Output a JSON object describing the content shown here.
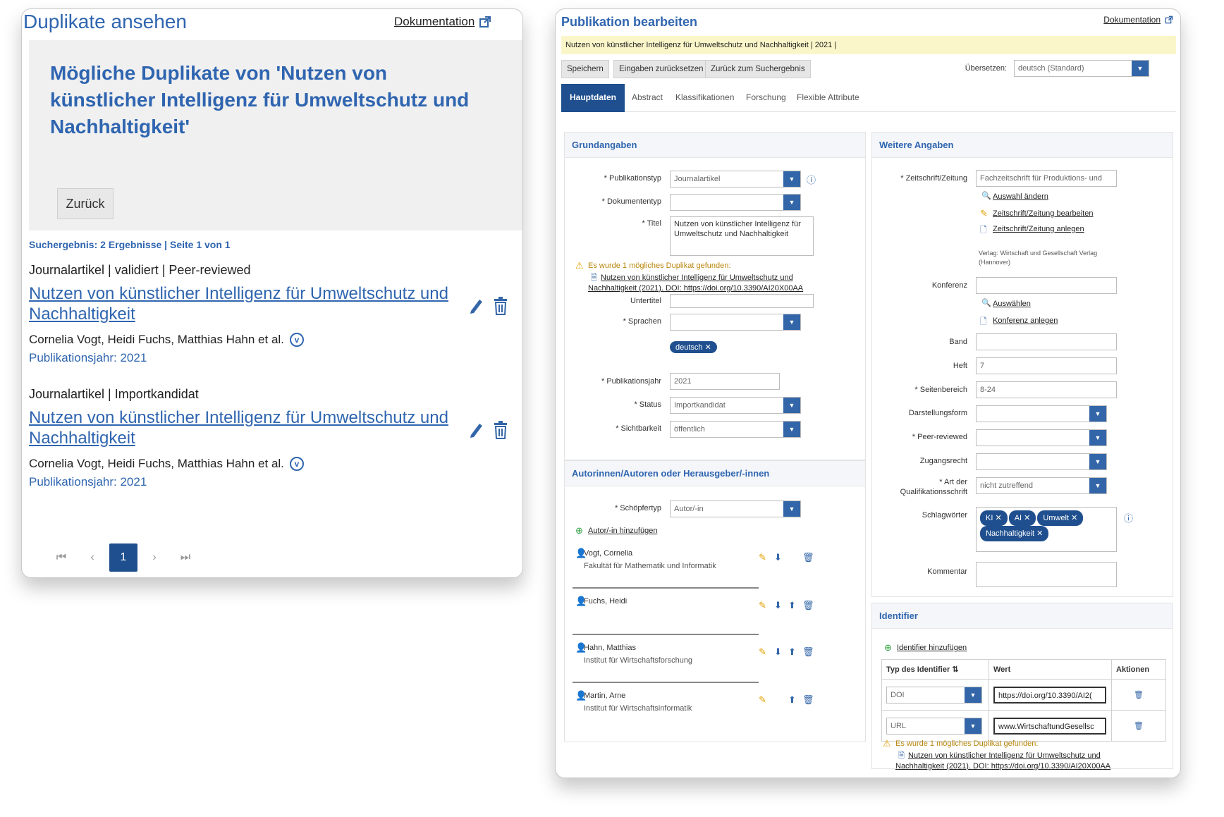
{
  "left": {
    "title": "Duplikate ansehen",
    "doc_label": "Dokumentation",
    "heading": "Mögliche Duplikate von 'Nutzen von künstlicher Intelligenz für Umweltschutz und Nachhaltigkeit'",
    "back_label": "Zurück",
    "search_result": "Suchergebnis: 2 Ergebnisse | Seite 1 von 1",
    "results": [
      {
        "meta": "Journalartikel | validiert | Peer-reviewed",
        "title": "Nutzen von künstlicher Intelligenz für Umweltschutz und Nachhaltigkeit",
        "authors": "Cornelia Vogt, Heidi Fuchs, Matthias Hahn et al.",
        "year": "Publikationsjahr: 2021"
      },
      {
        "meta": "Journalartikel | Importkandidat",
        "title": "Nutzen von künstlicher Intelligenz für Umweltschutz und Nachhaltigkeit",
        "authors": "Cornelia Vogt, Heidi Fuchs, Matthias Hahn et al.",
        "year": "Publikationsjahr: 2021"
      }
    ],
    "pager": {
      "current": "1"
    }
  },
  "right": {
    "title": "Publikation bearbeiten",
    "doc_label": "Dokumentation",
    "banner": "Nutzen von künstlicher Intelligenz für Umweltschutz und Nachhaltigkeit | 2021 |",
    "toolbar": {
      "save": "Speichern",
      "reset": "Eingaben zurücksetzen",
      "back": "Zurück zum Suchergebnis"
    },
    "translate": {
      "label": "Übersetzen:",
      "value": "deutsch (Standard)"
    },
    "tabs": [
      "Hauptdaten",
      "Abstract",
      "Klassifikationen",
      "Forschung",
      "Flexible Attribute"
    ],
    "grund": {
      "header": "Grundangaben",
      "pubtyp_label": "* Publikationstyp",
      "pubtyp_value": "Journalartikel",
      "doktyp_label": "* Dokumententyp",
      "doktyp_value": "",
      "titel_label": "* Titel",
      "titel_value": "Nutzen von künstlicher Intelligenz für Umweltschutz und Nachhaltigkeit",
      "dup_warning": "Es wurde 1 mögliches Duplikat gefunden:",
      "dup_link": "Nutzen von künstlicher Intelligenz für Umweltschutz und Nachhaltigkeit (2021). DOI: https://doi.org/10.3390/AI20X00AA",
      "untertitel_label": "Untertitel",
      "untertitel_value": "",
      "sprachen_label": "* Sprachen",
      "sprachen_tag": "deutsch",
      "pubjahr_label": "* Publikationsjahr",
      "pubjahr_value": "2021",
      "status_label": "* Status",
      "status_value": "Importkandidat",
      "sicht_label": "* Sichtbarkeit",
      "sicht_value": "öffentlich"
    },
    "autoren": {
      "header": "Autorinnen/Autoren oder Herausgeber/-innen",
      "schoepfer_label": "* Schöpfertyp",
      "schoepfer_value": "Autor/-in",
      "add_label": "Autor/-in hinzufügen",
      "people": [
        {
          "name": "Vogt, Cornelia",
          "inst": "Fakultät für Mathematik und Informatik"
        },
        {
          "name": "Fuchs, Heidi",
          "inst": ""
        },
        {
          "name": "Hahn, Matthias",
          "inst": "Institut für Wirtschaftsforschung"
        },
        {
          "name": "Martin, Arne",
          "inst": "Institut für Wirtschaftsinformatik"
        }
      ]
    },
    "weitere": {
      "header": "Weitere Angaben",
      "zeitschrift_label": "* Zeitschrift/Zeitung",
      "zeitschrift_value": "Fachzeitschrift für Produktions- und",
      "auswahl_aendern": "Auswahl ändern",
      "zs_bearbeiten": "Zeitschrift/Zeitung bearbeiten",
      "zs_anlegen": "Zeitschrift/Zeitung anlegen",
      "verlag": "Verlag: Wirtschaft und Gesellschaft Verlag (Hannover)",
      "konferenz_label": "Konferenz",
      "konferenz_value": "",
      "auswaehlen": "Auswählen",
      "konferenz_anlegen": "Konferenz anlegen",
      "band_label": "Band",
      "band_value": "",
      "heft_label": "Heft",
      "heft_value": "7",
      "seiten_label": "* Seitenbereich",
      "seiten_value": "8-24",
      "darst_label": "Darstellungsform",
      "darst_value": "",
      "peer_label": "* Peer-reviewed",
      "peer_value": "",
      "zugang_label": "Zugangsrecht",
      "zugang_value": "",
      "art_label_1": "* Art der",
      "art_label_2": "Qualifikationsschrift",
      "art_value": "nicht zutreffend",
      "schlag_label": "Schlagwörter",
      "tags": [
        "KI",
        "AI",
        "Umwelt",
        "Nachhaltigkeit"
      ],
      "kommentar_label": "Kommentar"
    },
    "identifier": {
      "header": "Identifier",
      "add_label": "Identifier hinzufügen",
      "col_type": "Typ des Identifier",
      "col_value": "Wert",
      "col_actions": "Aktionen",
      "rows": [
        {
          "type": "DOI",
          "value": "https://doi.org/10.3390/AI2("
        },
        {
          "type": "URL",
          "value": "www.WirtschaftundGesellsc"
        }
      ],
      "dup_warning": "Es wurde 1 mögliches Duplikat gefunden:",
      "dup_link": "Nutzen von künstlicher Intelligenz für Umweltschutz und Nachhaltigkeit (2021). DOI: https://doi.org/10.3390/AI20X00AA"
    }
  }
}
